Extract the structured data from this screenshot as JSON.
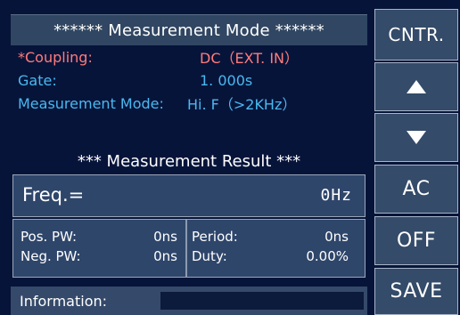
{
  "header": {
    "title": "****** Measurement Mode ******"
  },
  "settings": {
    "coupling": {
      "label": "*Coupling:",
      "value": "DC（EXT. IN）"
    },
    "gate": {
      "label": "Gate:",
      "value": "1. 000s"
    },
    "measurement_mode": {
      "label": "Measurement Mode:",
      "value": "Hi. F（>2KHz）"
    }
  },
  "result": {
    "header": "*** Measurement Result ***",
    "freq_label": "Freq.=",
    "freq_value": "0Hz",
    "pos_pw_label": "Pos. PW:",
    "pos_pw_value": "0ns",
    "neg_pw_label": "Neg. PW:",
    "neg_pw_value": "0ns",
    "period_label": "Period:",
    "period_value": "0ns",
    "duty_label": "Duty:",
    "duty_value": "0.00%"
  },
  "info": {
    "label": "Information:",
    "value": ""
  },
  "softkeys": {
    "cntr": "CNTR.",
    "up_icon": "up-arrow-icon",
    "down_icon": "down-arrow-icon",
    "ac": "AC",
    "off": "OFF",
    "save": "SAVE"
  },
  "colors": {
    "background": "#07143a",
    "panel": "#2f466b",
    "coupling_text": "#ff7b7b",
    "setting_text": "#4ab9f0",
    "text": "#ffffff"
  }
}
